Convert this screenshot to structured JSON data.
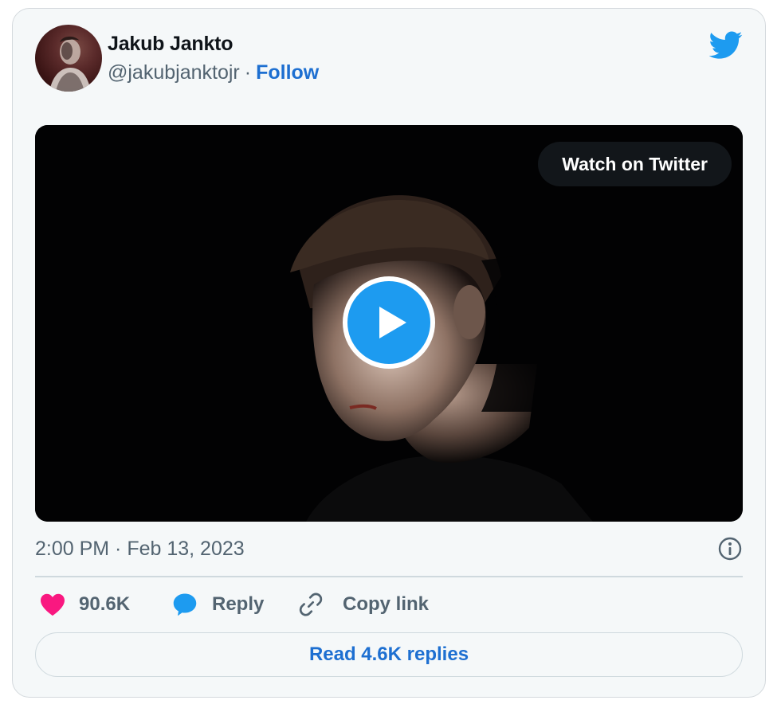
{
  "author": {
    "name": "Jakub Jankto",
    "handle": "@jakubjanktojr",
    "separator": "·",
    "follow_label": "Follow",
    "avatar_icon": "profile-photo"
  },
  "brand": {
    "icon": "twitter-bird-icon",
    "color": "#1d9bf0"
  },
  "media": {
    "watch_label": "Watch on Twitter",
    "play_icon": "play-icon",
    "play_color": "#1d9bf0"
  },
  "meta": {
    "timestamp": "2:00 PM · Feb 13, 2023",
    "info_icon": "info-icon"
  },
  "actions": {
    "like": {
      "icon": "heart-icon",
      "count": "90.6K",
      "color": "#f91880"
    },
    "reply": {
      "icon": "speech-bubble-icon",
      "label": "Reply",
      "color": "#1d9bf0"
    },
    "copy": {
      "icon": "link-icon",
      "label": "Copy link"
    }
  },
  "read_replies_label": "Read 4.6K replies"
}
